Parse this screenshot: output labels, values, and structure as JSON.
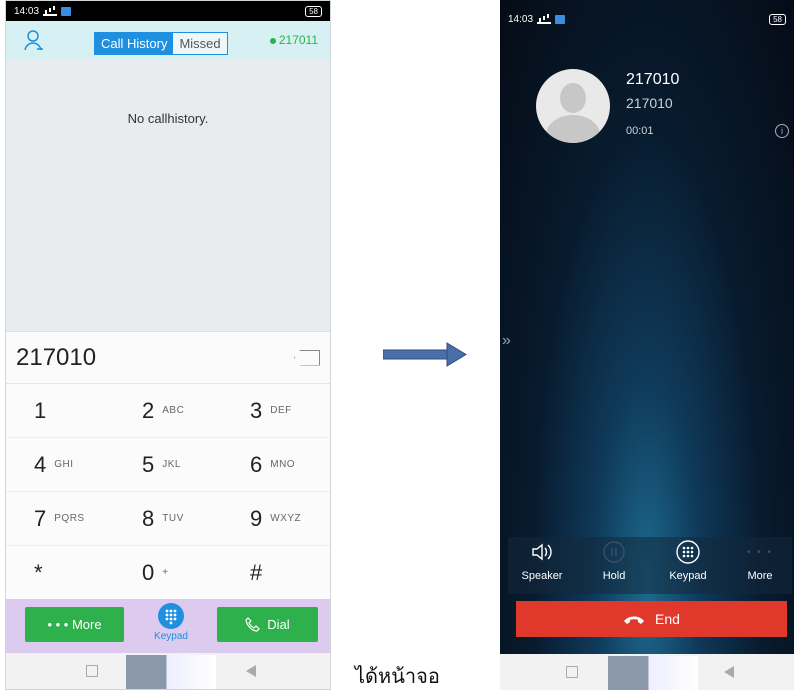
{
  "left_phone": {
    "status": {
      "time": "14:03",
      "battery": "58"
    },
    "header": {
      "tabs": [
        {
          "label": "Call History",
          "active": true
        },
        {
          "label": "Missed",
          "active": false
        }
      ],
      "account": "217011"
    },
    "history": {
      "empty_text": "No callhistory."
    },
    "dialer": {
      "input_value": "217010",
      "keys": [
        {
          "digit": "1",
          "letters": ""
        },
        {
          "digit": "2",
          "letters": "ABC"
        },
        {
          "digit": "3",
          "letters": "DEF"
        },
        {
          "digit": "4",
          "letters": "GHI"
        },
        {
          "digit": "5",
          "letters": "JKL"
        },
        {
          "digit": "6",
          "letters": "MNO"
        },
        {
          "digit": "7",
          "letters": "PQRS"
        },
        {
          "digit": "8",
          "letters": "TUV"
        },
        {
          "digit": "9",
          "letters": "WXYZ"
        },
        {
          "digit": "*",
          "letters": ""
        },
        {
          "digit": "0",
          "letters": "+"
        },
        {
          "digit": "#",
          "letters": ""
        }
      ]
    },
    "actions": {
      "more": "More",
      "keypad": "Keypad",
      "dial": "Dial"
    }
  },
  "caption": "ได้หน้าจอ",
  "right_phone": {
    "status": {
      "time": "14:03",
      "battery": "58"
    },
    "call": {
      "name": "217010",
      "number": "217010",
      "duration": "00:01"
    },
    "controls": [
      {
        "label": "Speaker",
        "icon": "speaker-icon",
        "enabled": true
      },
      {
        "label": "Hold",
        "icon": "pause-icon",
        "enabled": true
      },
      {
        "label": "Keypad",
        "icon": "keypad-icon",
        "enabled": true
      },
      {
        "label": "More",
        "icon": "more-dots-icon",
        "enabled": true
      }
    ],
    "end_label": "End"
  },
  "colors": {
    "accent_blue": "#1f8fe0",
    "green": "#2eb04c",
    "end_red": "#e0382b"
  }
}
